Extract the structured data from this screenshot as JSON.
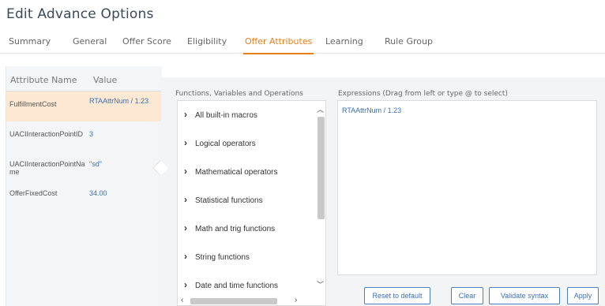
{
  "page": {
    "title": "Edit Advance Options"
  },
  "tabs": [
    {
      "label": "Summary"
    },
    {
      "label": "General"
    },
    {
      "label": "Offer Score"
    },
    {
      "label": "Eligibility"
    },
    {
      "label": "Offer Attributes",
      "active": true
    },
    {
      "label": "Learning"
    },
    {
      "label": "Rule Group"
    }
  ],
  "attributes": {
    "header": {
      "name": "Attribute Name",
      "value": "Value"
    },
    "rows": [
      {
        "name": "FulfillmentCost",
        "value": "RTAAttrNum / 1.23",
        "selected": true
      },
      {
        "name": "UACIInteractionPointID",
        "value": "3"
      },
      {
        "name": "UACIInteractionPointName",
        "value": "\"sd\""
      },
      {
        "name": "OfferFixedCost",
        "value": "34.00"
      }
    ]
  },
  "functions": {
    "label": "Functions, Variables and Operations",
    "items": [
      "All built-in macros",
      "Logical operators",
      "Mathematical operators",
      "Statistical functions",
      "Math and trig functions",
      "String functions",
      "Date and time functions"
    ]
  },
  "expression": {
    "label": "Expressions (Drag from left or type @ to select)",
    "value": "RTAAttrNum / 1.23"
  },
  "buttons": {
    "reset": "Reset to default",
    "clear": "Clear",
    "validate": "Validate syntax",
    "apply": "Apply"
  },
  "colors": {
    "accent": "#e8801a",
    "link": "#3b6fb5",
    "selected_row": "#fde9d3",
    "panel_bg": "#f3f4f6"
  },
  "icons": {
    "expand": "chevron-right-icon",
    "scroll_up": "chevron-up-icon",
    "scroll_down": "chevron-down-icon",
    "scroll_left": "chevron-left-icon",
    "scroll_right": "chevron-right-icon"
  }
}
